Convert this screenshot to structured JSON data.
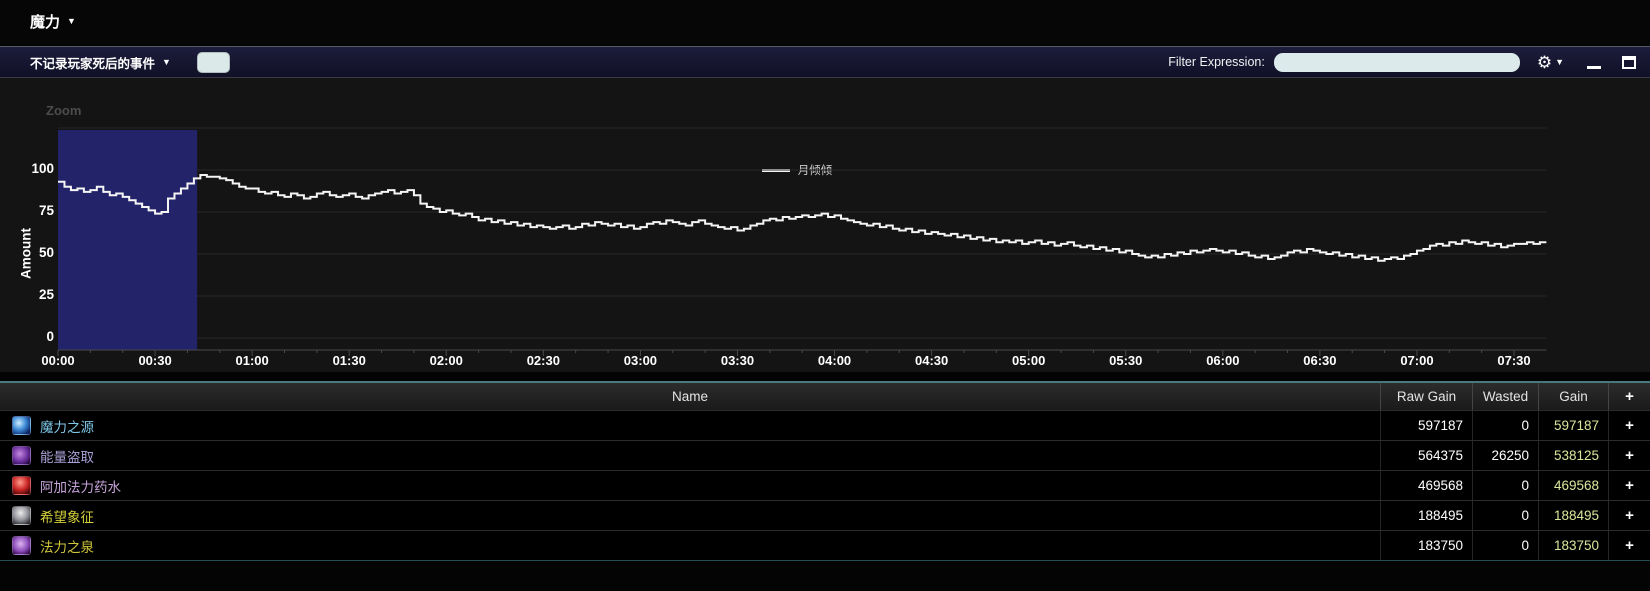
{
  "page": {
    "title": "魔力",
    "caret": "▼"
  },
  "toolbar": {
    "death_filter_label": "不记录玩家死后的事件",
    "caret": "▼",
    "filter_label": "Filter Expression:",
    "filter_value": "",
    "gear_glyph": "⚙"
  },
  "chart_data": {
    "type": "line",
    "title": "Zoom",
    "ylabel": "Amount",
    "ylim": [
      0,
      100
    ],
    "y_ticks": [
      100,
      75,
      50,
      25,
      0
    ],
    "x_ticks": [
      "00:00",
      "00:30",
      "01:00",
      "01:30",
      "02:00",
      "02:30",
      "03:00",
      "03:30",
      "04:00",
      "04:30",
      "05:00",
      "05:30",
      "06:00",
      "06:30",
      "07:00",
      "07:30"
    ],
    "legend": [
      {
        "name": "月倾倾",
        "color": "#f5f5f5"
      }
    ],
    "minutes_per_point": 2,
    "selection": {
      "start_min": 0,
      "end_min": 43
    },
    "grid": true,
    "values": [
      93,
      90,
      88,
      89,
      87,
      88,
      90,
      87,
      85,
      86,
      84,
      82,
      80,
      78,
      76,
      74,
      75,
      83,
      86,
      89,
      92,
      95,
      97,
      96,
      96,
      95,
      94,
      92,
      90,
      89,
      89,
      87,
      86,
      87,
      85,
      84,
      86,
      85,
      83,
      84,
      86,
      87,
      85,
      84,
      85,
      86,
      84,
      83,
      85,
      86,
      87,
      88,
      86,
      87,
      88,
      85,
      80,
      78,
      77,
      75,
      76,
      74,
      73,
      74,
      72,
      70,
      71,
      69,
      70,
      68,
      69,
      67,
      68,
      66,
      67,
      66,
      65,
      66,
      67,
      65,
      66,
      68,
      67,
      69,
      68,
      67,
      68,
      66,
      67,
      65,
      66,
      68,
      69,
      68,
      70,
      69,
      68,
      67,
      69,
      70,
      68,
      67,
      66,
      65,
      66,
      64,
      65,
      67,
      68,
      70,
      71,
      70,
      72,
      71,
      72,
      73,
      72,
      73,
      74,
      72,
      73,
      71,
      70,
      69,
      68,
      67,
      68,
      66,
      67,
      65,
      64,
      65,
      63,
      64,
      62,
      63,
      62,
      61,
      62,
      60,
      61,
      59,
      60,
      58,
      59,
      57,
      58,
      57,
      58,
      56,
      57,
      58,
      56,
      57,
      55,
      56,
      57,
      55,
      54,
      55,
      53,
      54,
      52,
      53,
      51,
      52,
      50,
      49,
      48,
      49,
      48,
      50,
      49,
      51,
      50,
      52,
      51,
      52,
      53,
      52,
      51,
      52,
      50,
      51,
      49,
      48,
      49,
      47,
      48,
      49,
      51,
      52,
      51,
      53,
      52,
      51,
      50,
      51,
      49,
      50,
      48,
      49,
      47,
      48,
      46,
      47,
      48,
      47,
      49,
      50,
      52,
      53,
      55,
      56,
      55,
      57,
      56,
      58,
      57,
      56,
      57,
      55,
      56,
      54,
      55,
      56,
      56,
      57,
      56,
      57,
      57
    ]
  },
  "table": {
    "columns": [
      "Name",
      "Raw Gain",
      "Wasted",
      "Gain",
      "+"
    ],
    "rows": [
      {
        "name": "魔力之源",
        "color": "#7fc7e8",
        "icon": "mana-gem-icon",
        "raw": "597187",
        "wasted": "0",
        "gain": "597187"
      },
      {
        "name": "能量盗取",
        "color": "#a9a0d6",
        "icon": "siphon-energy-icon",
        "raw": "564375",
        "wasted": "26250",
        "gain": "538125"
      },
      {
        "name": "阿加法力药水",
        "color": "#c7a3da",
        "icon": "mana-potion-icon",
        "raw": "469568",
        "wasted": "0",
        "gain": "469568"
      },
      {
        "name": "希望象征",
        "color": "#d5d13a",
        "icon": "symbol-of-hope-icon",
        "raw": "188495",
        "wasted": "0",
        "gain": "188495"
      },
      {
        "name": "法力之泉",
        "color": "#cfc63c",
        "icon": "mana-spring-icon",
        "raw": "183750",
        "wasted": "0",
        "gain": "183750"
      }
    ],
    "plus": "+"
  }
}
